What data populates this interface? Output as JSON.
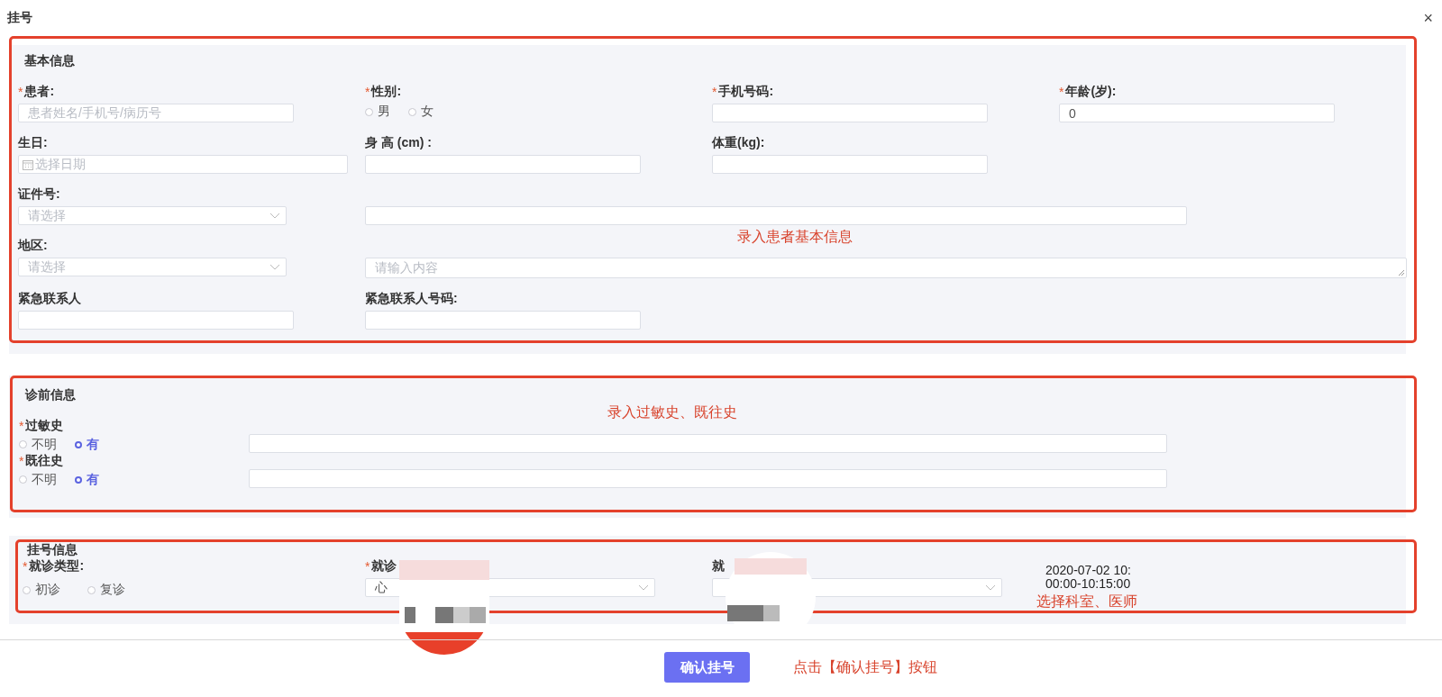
{
  "dialog": {
    "title": "挂号",
    "close": "×"
  },
  "basic": {
    "title": "基本信息",
    "annotation": "录入患者基本信息",
    "rows": [
      [
        {
          "kind": "text",
          "label": "患者:",
          "required_mark": "*",
          "placeholder": "患者姓名/手机号/病历号"
        },
        {
          "kind": "radio",
          "label": "性别:",
          "required_mark": "*",
          "options": [
            {
              "label": "男",
              "selected": false
            },
            {
              "label": "女",
              "selected": false
            }
          ]
        },
        {
          "kind": "text",
          "label": "手机号码:",
          "required_mark": "*"
        },
        {
          "kind": "text",
          "label": "年龄(岁):",
          "required_mark": "*",
          "value": "0"
        }
      ],
      [
        {
          "kind": "date",
          "label": "生日:",
          "placeholder": "选择日期"
        },
        {
          "kind": "text",
          "label": "身 高 (cm) :"
        },
        {
          "kind": "text",
          "label": "体重(kg):"
        }
      ],
      [
        {
          "kind": "select",
          "label": "证件号:",
          "placeholder": "请选择"
        },
        {
          "kind": "wide"
        }
      ],
      [
        {
          "kind": "select",
          "label": "地区:",
          "placeholder": "请选择"
        },
        {
          "kind": "textarea",
          "placeholder": "请输入内容"
        }
      ],
      [
        {
          "kind": "text",
          "label": "紧急联系人"
        },
        {
          "kind": "text",
          "label": "紧急联系人号码:"
        }
      ]
    ]
  },
  "history": {
    "title": "诊前信息",
    "annotation": "录入过敏史、既往史",
    "items": [
      {
        "label": "过敏史",
        "required_mark": "*",
        "options": [
          {
            "label": "不明",
            "selected": false
          },
          {
            "label": "有",
            "selected": true
          }
        ]
      },
      {
        "label": "既往史",
        "required_mark": "*",
        "options": [
          {
            "label": "不明",
            "selected": false
          },
          {
            "label": "有",
            "selected": true
          }
        ]
      }
    ]
  },
  "registration": {
    "title": "挂号信息",
    "annotation": "选择科室、医师",
    "type": {
      "label": "就诊类型:",
      "required_mark": "*",
      "options": [
        {
          "label": "初诊",
          "selected": false
        },
        {
          "label": "复诊",
          "selected": false
        }
      ]
    },
    "department": {
      "label": "就诊",
      "required_mark": "*",
      "value": "心"
    },
    "doctor": {
      "label": "就"
    },
    "time": [
      "2020-07-02 10:",
      "00:00-10:15:00"
    ]
  },
  "footer": {
    "button": "确认挂号",
    "annotation": "点击【确认挂号】按钮"
  }
}
